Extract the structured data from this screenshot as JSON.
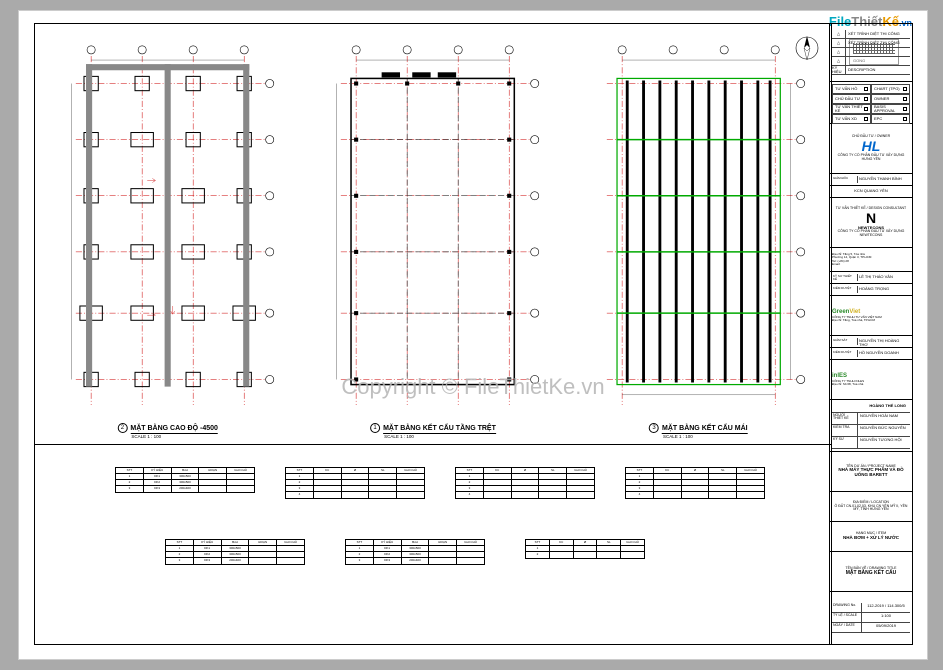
{
  "site_badge": {
    "file": "File",
    "thiet": "Thiết",
    "ke": "Kế",
    "vn": ".vn"
  },
  "watermark": "Copyright © FileThietKe.vn",
  "plans": [
    {
      "num": "2",
      "title": "MẶT BẰNG CAO ĐỘ -4500",
      "scale": "SCALE   1 : 100"
    },
    {
      "num": "1",
      "title": "MẶT BẰNG KẾT CẤU TẦNG TRỆT",
      "scale": "SCALE   1 : 100"
    },
    {
      "num": "3",
      "title": "MẶT BẰNG KẾT CẤU MÁI",
      "scale": "SCALE   1 : 100"
    }
  ],
  "titleblock": {
    "revisions": [
      {
        "sym": "△",
        "desc": "XÉT TRÌNH DIỆT THI CÔNG"
      },
      {
        "sym": "△",
        "desc": "XÉT TRÌNH DIỆT THI CÔNG"
      },
      {
        "sym": "△",
        "desc": ""
      },
      {
        "sym": "△",
        "desc": ""
      },
      {
        "sym": "KÝ HIỆU",
        "desc": "DESCRIPTION"
      }
    ],
    "checks": [
      "TƯ VẤN HỒ",
      "CHART (TPG)",
      "CHỦ ĐẦU TƯ",
      "OWNER",
      "TƯ VẤN THIẾT KẾ",
      "BASIS APPROVAL",
      "TƯ VẤN XD",
      "EPC"
    ],
    "owner_label": "CHỦ ĐẦU TƯ / OWNER",
    "owner_company": "CÔNG TY CỔ PHẦN ĐẦU TƯ XÂY DỰNG HƯNG YÊN",
    "owner_name": "NGUYỄN THANH BÌNH",
    "owner_addr": "KCN QUANG YÊN",
    "designer_label": "TƯ VẤN THIẾT KẾ / DESIGN CONSULTANT",
    "designer_brand": "NEWTECONS",
    "designer_company": "CÔNG TY CỔ PHẦN ĐẦU TƯ XÂY DỰNG NEWTECONS",
    "designer_addr1": "Địa chỉ: Tầng 5, Tòa nhà",
    "designer_addr2": "Phường 14, Quận 3, TP.HCM",
    "designer_tel": "Tel: (+84) 28",
    "designer_email": "Email:",
    "designer_engineer_label": "KỸ SƯ THIẾT KẾ",
    "designer_engineer": "LÊ THỊ THÁO VÂN",
    "designer_qc_label": "KIỂM DUYỆT",
    "designer_qc": "HOÀNG TRỌNG",
    "green_company": "CÔNG TY TNHH TƯ VẤN VIỆT NAM",
    "green_addr": "Địa chỉ: Tầng, Tòa nhà, TP.HCM",
    "green_engineer_label": "GIÁM SÁT",
    "green_engineer": "NGUYỄN THỊ HOÀNG THƠ",
    "green_qc_label": "KIỂM DUYỆT",
    "green_qc": "HỒ NGUYỄN DOANH",
    "inl_company": "CÔNG TY TNHH INLES",
    "inl_addr": "Địa chỉ: Số 68, Tòa nhà",
    "sign_hdr": "HOÀNG THẾ LONG",
    "signs": [
      {
        "role": "NGƯỜI THIẾT KẾ",
        "name": "NGUYỄN HOÀI NAM"
      },
      {
        "role": "KIỂM TRA",
        "name": "NGUYỄN ĐỨC NGUYÊN"
      },
      {
        "role": "KỸ SƯ",
        "name": "NGUYỄN TƯƠNG HỘI"
      }
    ],
    "project_label": "TÊN DỰ ÁN / PROJECT NAME",
    "project": "NHÀ MÁY THỰC PHẨM VÀ ĐỒ UỐNG BARETT",
    "location_label": "ĐỊA ĐIỂM / LOCATION",
    "location": "Ô ĐẤT CN.01,02,03, KHU CN YÊN MỸ II, YÊN MỸ, TỈNH HƯNG YÊN",
    "item_label": "HẠNG MỤC / ITEM",
    "item": "NHÀ BƠM + XỬ LÝ NƯỚC",
    "drawing_label": "TÊN BẢN VẼ / DRAWING TITLE",
    "drawing_title": "MẶT BẰNG KẾT CẤU",
    "numbers": [
      {
        "label": "DRAWING No.",
        "val": "112-2019 / 114.300/5"
      },
      {
        "label": "TỶ LỆ / SCALE",
        "val": "1:100"
      },
      {
        "label": "NGÀY / DATE",
        "val": "05/09/2019"
      }
    ]
  },
  "tables": {
    "t1_hdr": [
      "STT",
      "KÝ HIỆU",
      "BxH",
      "ĐOẠN",
      "GHI CHÚ"
    ],
    "t1_rows": [
      [
        "1",
        "DK1",
        "300x500",
        "",
        ""
      ],
      [
        "2",
        "DK2",
        "300x500",
        "",
        ""
      ],
      [
        "3",
        "DK3",
        "200x400",
        "",
        ""
      ]
    ],
    "t2_hdr": [
      "STT",
      "KC",
      "Ø",
      "SL",
      "GHI CHÚ"
    ],
    "t3_rows": [
      [
        "1",
        "",
        "",
        "",
        ""
      ],
      [
        "2",
        "",
        "",
        "",
        ""
      ],
      [
        "3",
        "",
        "",
        "",
        ""
      ],
      [
        "4",
        "",
        "",
        "",
        ""
      ]
    ]
  }
}
